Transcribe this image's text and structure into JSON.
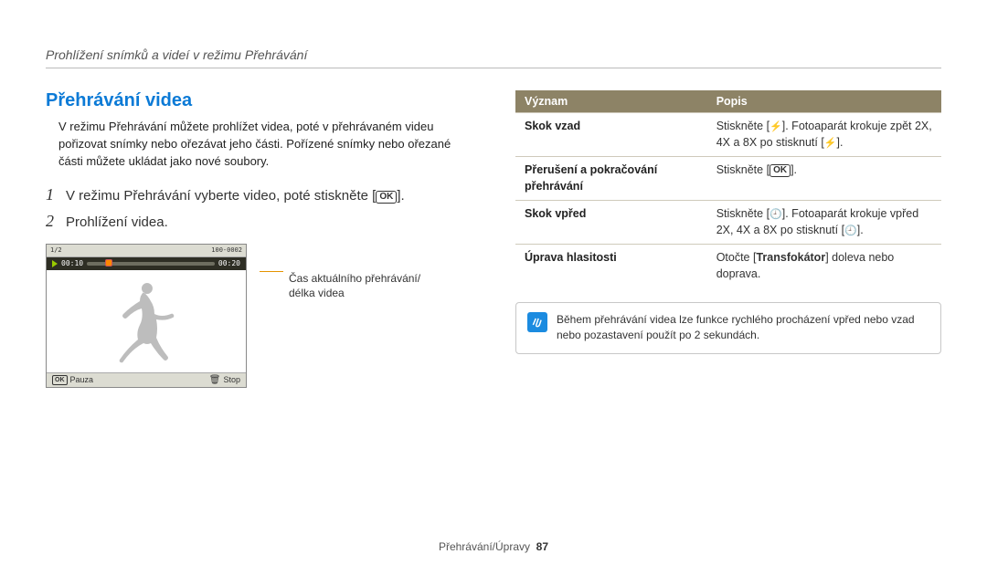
{
  "breadcrumb": "Prohlížení snímků a videí v režimu Přehrávání",
  "section_title": "Přehrávání videa",
  "intro": "V režimu Přehrávání můžete prohlížet videa, poté v přehrávaném videu pořizovat snímky nebo ořezávat jeho části. Pořízené snímky nebo ořezané části můžete ukládat jako nové soubory.",
  "steps": {
    "s1_num": "1",
    "s1_pre": "V režimu Přehrávání vyberte video, poté stiskněte [",
    "s1_ok": "OK",
    "s1_post": "].",
    "s2_num": "2",
    "s2_text": "Prohlížení videa."
  },
  "screen": {
    "top_frac": "1/2",
    "top_right": "100-0002",
    "time_cur": "00:10",
    "time_total": "00:20",
    "bottom_ok": "OK",
    "bottom_pause": "Pauza",
    "bottom_stop": "Stop"
  },
  "callout": "Čas aktuálního přehrávání/\ndélka videa",
  "table": {
    "h1": "Význam",
    "h2": "Popis",
    "rows": [
      {
        "term": "Skok vzad",
        "desc_pre": "Stiskněte [",
        "desc_icon": "flash",
        "desc_mid": "]. Fotoaparát krokuje zpět 2X, 4X a 8X po stisknutí [",
        "desc_icon2": "flash",
        "desc_post": "]."
      },
      {
        "term": "Přerušení a pokračování přehrávání",
        "desc_pre": "Stiskněte [",
        "desc_icon": "ok",
        "desc_mid": "",
        "desc_icon2": "",
        "desc_post": "]."
      },
      {
        "term": "Skok vpřed",
        "desc_pre": "Stiskněte [",
        "desc_icon": "timer",
        "desc_mid": "]. Fotoaparát krokuje vpřed 2X, 4X a 8X po stisknutí [",
        "desc_icon2": "timer",
        "desc_post": "]."
      },
      {
        "term": "Úprava hlasitosti",
        "desc_plain_pre": "Otočte [",
        "desc_bold": "Transfokátor",
        "desc_plain_post": "] doleva nebo doprava."
      }
    ]
  },
  "note": "Během přehrávání videa lze funkce rychlého procházení vpřed nebo vzad nebo pozastavení použít po 2 sekundách.",
  "footer_label": "Přehrávání/Úpravy",
  "footer_page": "87"
}
